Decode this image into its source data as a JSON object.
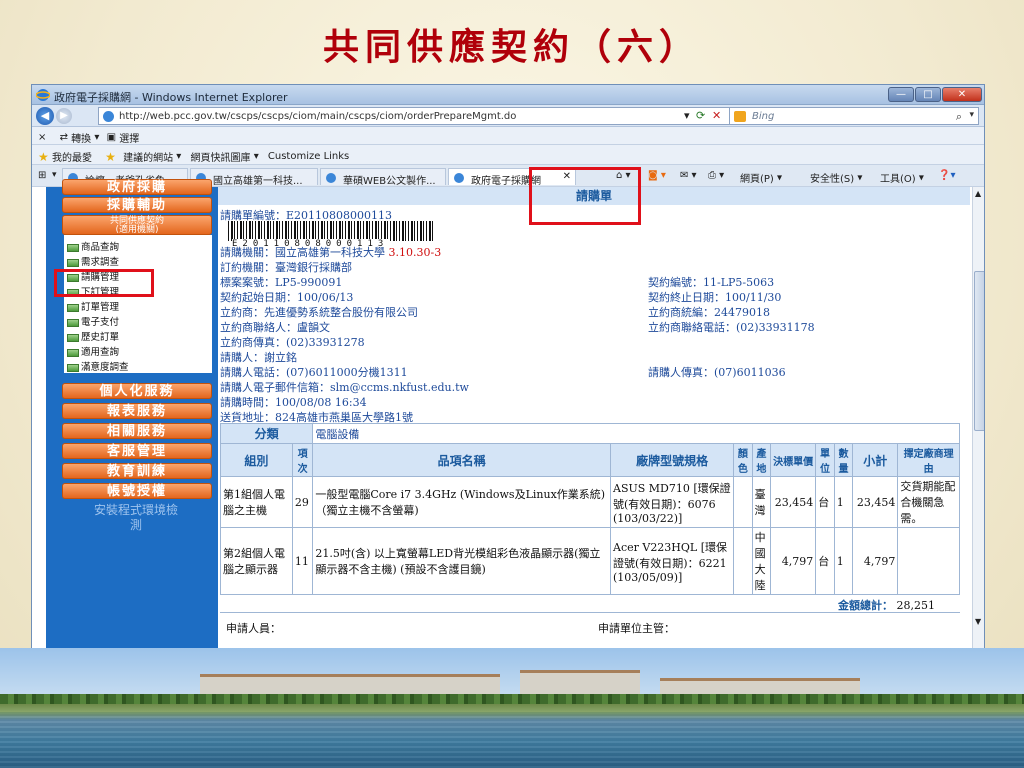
{
  "slide": {
    "title": "共同供應契約（六）"
  },
  "window": {
    "title": "政府電子採購網 - Windows Internet Explorer",
    "url": "http://web.pcc.gov.tw/cscps/cscps/ciom/main/cscps/ciom/orderPrepareMgmt.do",
    "search_placeholder": "Bing"
  },
  "toolbar": {
    "translate_close": "×",
    "translate": "轉換",
    "select": "選擇",
    "favorites": "我的最愛",
    "suggested_sites": "建議的網站",
    "web_slice": "網頁快訊圖庫",
    "customize_links": "Customize Links",
    "tabs": [
      "論壇 - 老爹孔雀魚...",
      "國立高雄第一科技...",
      "華碩WEB公文製作...",
      "政府電子採購網"
    ],
    "page_menu": "網頁(P)",
    "safety_menu": "安全性(S)",
    "tools_menu": "工具(O)"
  },
  "sidebar": {
    "top_cut": "政府採購",
    "assist": "採購輔助",
    "contract_line1": "共同供應契約",
    "contract_line2": "(適用機關)",
    "items": [
      "商品查詢",
      "需求調查",
      "請購管理",
      "下訂管理",
      "訂單管理",
      "電子支付",
      "歷史訂單",
      "適用查詢",
      "滿意度調查"
    ],
    "buttons": [
      "個人化服務",
      "報表服務",
      "相關服務",
      "客服管理",
      "教育訓練",
      "帳號授權"
    ],
    "install_line1": "安裝程式環境檢",
    "install_line2": "測"
  },
  "form": {
    "header": "請購單",
    "order_no": "請購單編號：E20110808000113",
    "barcode_text": "E20110808000113",
    "agency": "請購機關：國立高雄第一科技大學",
    "agency_code": "3.10.30-3",
    "contract_agency": "訂約機關：臺灣銀行採購部",
    "case_no": "標案案號：LP5-990091",
    "contract_no": "契約編號：11-LP5-5063",
    "start_date": "契約起始日期：100/06/13",
    "end_date": "契約終止日期：100/11/30",
    "vendor": "立約商：先進優勢系統整合股份有限公司",
    "vendor_tax": "立約商統編：24479018",
    "vendor_contact": "立約商聯絡人：盧韻文",
    "vendor_phone": "立約商聯絡電話：(02)33931178",
    "vendor_fax": "立約商傳真：(02)33931278",
    "requester": "請購人：謝立銘",
    "requester_phone": "請購人電話：(07)6011000分機1311",
    "requester_fax": "請購人傳真：(07)6011036",
    "requester_email": "請購人電子郵件信箱：slm@ccms.nkfust.edu.tw",
    "request_time": "請購時間：100/08/08 16:34",
    "delivery": "送貨地址：824高雄市燕巢區大學路1號",
    "category_label": "分類",
    "category_value": "電腦設備",
    "columns": [
      "組別",
      "項次",
      "品項名稱",
      "廠牌型號規格",
      "顏色",
      "產地",
      "決標單價",
      "單位",
      "數量",
      "小計",
      "擇定廠商理由"
    ],
    "rows": [
      {
        "group": "第1組個人電腦之主機",
        "item_no": "29",
        "name": "一般型電腦Core i7 3.4GHz (Windows及Linux作業系統)（獨立主機不含螢幕)",
        "brand": "ASUS MD710 [環保證號(有效日期)：6076 (103/03/22)]",
        "color": "",
        "origin": "臺灣",
        "price": "23,454",
        "unit": "台",
        "qty": "1",
        "subtotal": "23,454",
        "reason": "交貨期能配合機關急需。"
      },
      {
        "group": "第2組個人電腦之顯示器",
        "item_no": "11",
        "name": "21.5吋(含) 以上寬螢幕LED背光模組彩色液晶顯示器(獨立顯示器不含主機) (預設不含護目鏡)",
        "brand": "Acer V223HQL [環保證號(有效日期)：6221 (103/05/09)]",
        "color": "",
        "origin": "中國大陸",
        "price": "4,797",
        "unit": "台",
        "qty": "1",
        "subtotal": "4,797",
        "reason": ""
      }
    ],
    "total_label": "金額總計：",
    "total_value": "28,251",
    "applicant": "申請人員：",
    "supervisor": "申請單位主管："
  }
}
